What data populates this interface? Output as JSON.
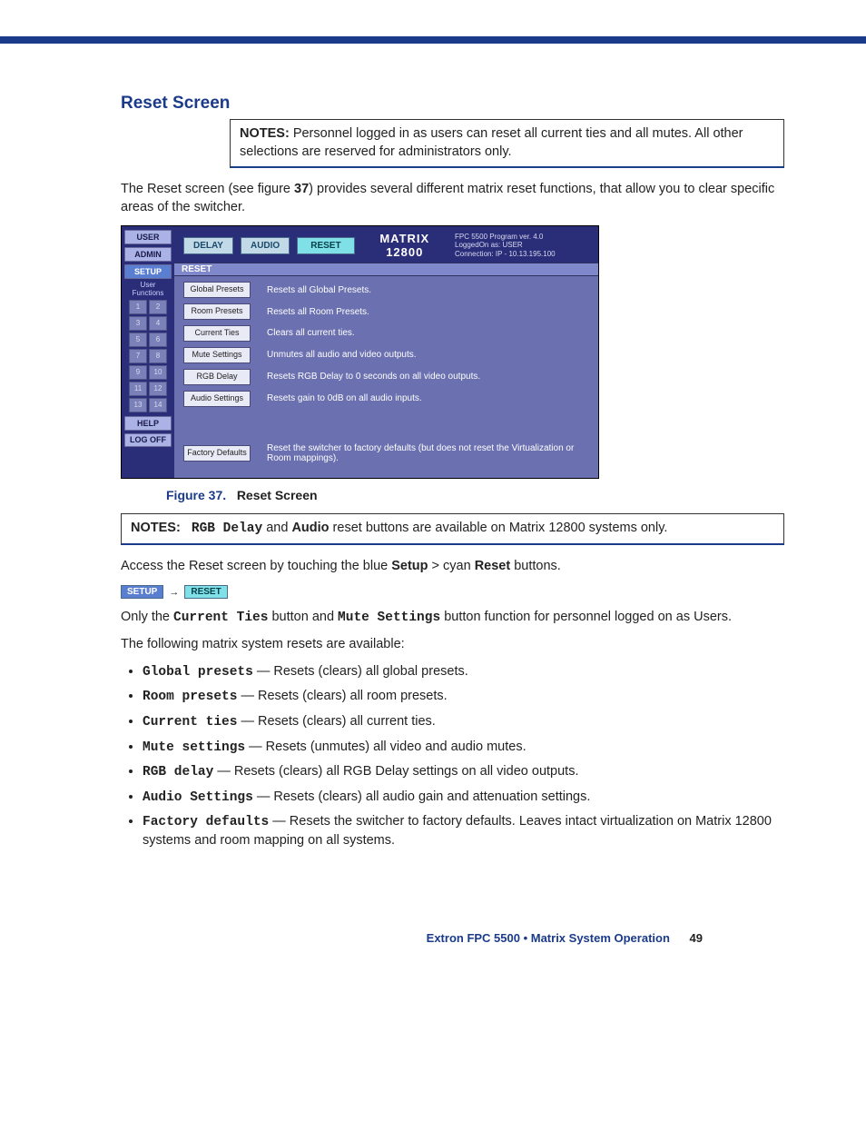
{
  "heading": "Reset Screen",
  "note1_label": "NOTES:",
  "note1_text": "Personnel logged in as users can reset all current ties and all mutes. All other selections are reserved for administrators only.",
  "para1_a": "The Reset screen (see figure ",
  "para1_b": "37",
  "para1_c": ") provides several different matrix reset functions, that allow you to clear specific areas of the switcher.",
  "screenshot": {
    "side": {
      "user": "USER",
      "admin": "ADMIN",
      "setup": "SETUP",
      "uflabel": "User Functions",
      "nums": [
        "1",
        "2",
        "3",
        "4",
        "5",
        "6",
        "7",
        "8",
        "9",
        "10",
        "11",
        "12",
        "13",
        "14"
      ],
      "help": "HELP",
      "logoff": "LOG OFF"
    },
    "top": {
      "delay": "DELAY",
      "audio": "AUDIO",
      "reset": "RESET",
      "product": "MATRIX 12800",
      "meta1": "FPC 5500 Program  ver. 4.0",
      "meta2": "LoggedOn as: USER",
      "meta3": "Connection: IP - 10.13.195.100"
    },
    "panelTitle": "RESET",
    "rows": [
      {
        "btn": "Global Presets",
        "desc": "Resets all Global Presets."
      },
      {
        "btn": "Room Presets",
        "desc": "Resets all Room Presets."
      },
      {
        "btn": "Current Ties",
        "desc": "Clears all current ties."
      },
      {
        "btn": "Mute Settings",
        "desc": "Unmutes all audio and video outputs."
      },
      {
        "btn": "RGB Delay",
        "desc": "Resets RGB  Delay to 0 seconds on all video outputs."
      },
      {
        "btn": "Audio Settings",
        "desc": "Resets gain to 0dB on all audio inputs."
      }
    ],
    "factory": {
      "btn": "Factory Defaults",
      "desc": "Reset the switcher to factory defaults (but does not reset the Virtualization or Room mappings)."
    }
  },
  "figcap_num": "Figure 37.",
  "figcap_title": "Reset Screen",
  "note2_label": "NOTES:",
  "note2_a": "RGB Delay",
  "note2_b": " and ",
  "note2_c": "Audio",
  "note2_d": " reset buttons are available on Matrix 12800 systems only.",
  "para2_a": "Access the Reset screen by touching the blue ",
  "para2_b": "Setup",
  "para2_c": " > cyan ",
  "para2_d": "Reset",
  "para2_e": " buttons.",
  "inlinebtn_setup": "SETUP",
  "inlinebtn_reset": "RESET",
  "para3_a": "Only the ",
  "para3_b": "Current Ties",
  "para3_c": " button and ",
  "para3_d": "Mute Settings",
  "para3_e": " button function for personnel logged on as Users.",
  "para4": "The following matrix system resets are available:",
  "bullets": [
    {
      "name": "Global presets",
      "desc": " — Resets (clears) all global presets."
    },
    {
      "name": "Room presets",
      "desc": " — Resets (clears) all room presets."
    },
    {
      "name": "Current ties",
      "desc": " — Resets (clears) all current ties."
    },
    {
      "name": "Mute settings",
      "desc": " — Resets (unmutes) all video and audio mutes."
    },
    {
      "name": "RGB delay",
      "desc": " — Resets (clears) all RGB Delay settings on all video outputs."
    },
    {
      "name": "Audio Settings",
      "desc": " — Resets (clears) all audio gain and attenuation settings."
    },
    {
      "name": "Factory defaults",
      "desc": " — Resets the switcher to factory defaults. Leaves intact virtualization on Matrix 12800 systems and room mapping on all systems."
    }
  ],
  "footer_title": "Extron FPC 5500 • Matrix System Operation",
  "footer_page": "49"
}
